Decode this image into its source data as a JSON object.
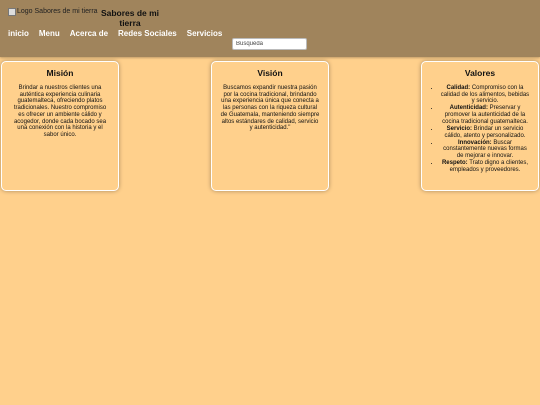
{
  "header": {
    "logo_alt": "Logo Sabores de mi tierra",
    "title": "Sabores de mi tierra"
  },
  "nav": {
    "items": [
      "inicio",
      "Menu",
      "Acerca de",
      "Redes Sociales",
      "Servicios"
    ]
  },
  "search": {
    "placeholder": "Busqueda",
    "value": ""
  },
  "cards": [
    {
      "title": "Misión",
      "text": "Brindar a nuestros clientes una auténtica experiencia culinaria guatemalteca, ofreciendo platos tradicionales. Nuestro compromiso es ofrecer un ambiente cálido y acogedor, donde cada bocado sea una conexión con la historia y el sabor único."
    },
    {
      "title": "Visión",
      "text": "Buscamos expandir nuestra pasión por la cocina tradicional, brindando una experiencia única que conecta a las personas con la riqueza cultural de Guatemala, manteniendo siempre altos estándares de calidad, servicio y autenticidad.\""
    },
    {
      "title": "Valores",
      "items": [
        {
          "term": "Calidad:",
          "desc": "Compromiso con la calidad de los alimentos, bebidas y servicio."
        },
        {
          "term": "Autenticidad:",
          "desc": "Preservar y promover la autenticidad de la cocina tradicional guatemalteca."
        },
        {
          "term": "Servicio:",
          "desc": "Brindar un servicio cálido, atento y personalizado."
        },
        {
          "term": "Innovación:",
          "desc": "Buscar constantemente nuevas formas de mejorar e innovar."
        },
        {
          "term": "Respeto:",
          "desc": "Trato digno a clientes, empleados y proveedores."
        }
      ]
    }
  ],
  "colors": {
    "background": "#ffd08c",
    "header": "#a0845c",
    "nav_text": "#ffffff"
  }
}
